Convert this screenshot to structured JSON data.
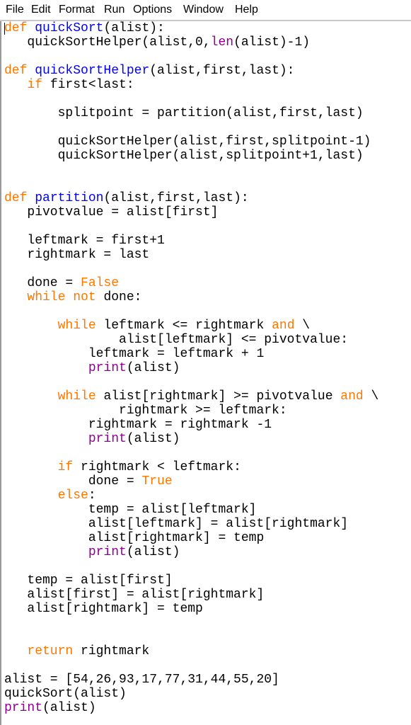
{
  "menu": [
    "File",
    "Edit",
    "Format",
    "Run",
    "Options",
    "Window",
    "Help"
  ],
  "colors": {
    "keyword": "#ff7700",
    "definition": "#0000ff",
    "builtin": "#900090",
    "text": "#000000"
  },
  "code_lines": [
    [
      [
        "def",
        "k"
      ],
      [
        " "
      ],
      [
        "quickSort",
        "d"
      ],
      [
        "(alist):"
      ]
    ],
    [
      [
        "   quickSortHelper(alist,0,"
      ],
      [
        "len",
        "b"
      ],
      [
        "(alist)-1)"
      ]
    ],
    [],
    [
      [
        "def",
        "k"
      ],
      [
        " "
      ],
      [
        "quickSortHelper",
        "d"
      ],
      [
        "(alist,first,last):"
      ]
    ],
    [
      [
        "   "
      ],
      [
        "if",
        "k"
      ],
      [
        " first<last:"
      ]
    ],
    [],
    [
      [
        "       splitpoint = partition(alist,first,last)"
      ]
    ],
    [],
    [
      [
        "       quickSortHelper(alist,first,splitpoint-1)"
      ]
    ],
    [
      [
        "       quickSortHelper(alist,splitpoint+1,last)"
      ]
    ],
    [],
    [],
    [
      [
        "def",
        "k"
      ],
      [
        " "
      ],
      [
        "partition",
        "d"
      ],
      [
        "(alist,first,last):"
      ]
    ],
    [
      [
        "   pivotvalue = alist[first]"
      ]
    ],
    [],
    [
      [
        "   leftmark = first+1"
      ]
    ],
    [
      [
        "   rightmark = last"
      ]
    ],
    [],
    [
      [
        "   done = "
      ],
      [
        "False",
        "k"
      ]
    ],
    [
      [
        "   "
      ],
      [
        "while",
        "k"
      ],
      [
        " "
      ],
      [
        "not",
        "k"
      ],
      [
        " done:"
      ]
    ],
    [],
    [
      [
        "       "
      ],
      [
        "while",
        "k"
      ],
      [
        " leftmark <= rightmark "
      ],
      [
        "and",
        "k"
      ],
      [
        " \\"
      ]
    ],
    [
      [
        "               alist[leftmark] <= pivotvalue:"
      ]
    ],
    [
      [
        "           leftmark = leftmark + 1"
      ]
    ],
    [
      [
        "           "
      ],
      [
        "print",
        "b"
      ],
      [
        "(alist)"
      ]
    ],
    [],
    [
      [
        "       "
      ],
      [
        "while",
        "k"
      ],
      [
        " alist[rightmark] >= pivotvalue "
      ],
      [
        "and",
        "k"
      ],
      [
        " \\"
      ]
    ],
    [
      [
        "               rightmark >= leftmark:"
      ]
    ],
    [
      [
        "           rightmark = rightmark -1"
      ]
    ],
    [
      [
        "           "
      ],
      [
        "print",
        "b"
      ],
      [
        "(alist)"
      ]
    ],
    [],
    [
      [
        "       "
      ],
      [
        "if",
        "k"
      ],
      [
        " rightmark < leftmark:"
      ]
    ],
    [
      [
        "           done = "
      ],
      [
        "True",
        "k"
      ]
    ],
    [
      [
        "       "
      ],
      [
        "else",
        "k"
      ],
      [
        ":"
      ]
    ],
    [
      [
        "           temp = alist[leftmark]"
      ]
    ],
    [
      [
        "           alist[leftmark] = alist[rightmark]"
      ]
    ],
    [
      [
        "           alist[rightmark] = temp"
      ]
    ],
    [
      [
        "           "
      ],
      [
        "print",
        "b"
      ],
      [
        "(alist)"
      ]
    ],
    [],
    [
      [
        "   temp = alist[first]"
      ]
    ],
    [
      [
        "   alist[first] = alist[rightmark]"
      ]
    ],
    [
      [
        "   alist[rightmark] = temp"
      ]
    ],
    [],
    [],
    [
      [
        "   "
      ],
      [
        "return",
        "k"
      ],
      [
        " rightmark"
      ]
    ],
    [],
    [
      [
        "alist = [54,26,93,17,77,31,44,55,20]"
      ]
    ],
    [
      [
        "quickSort(alist)"
      ]
    ],
    [
      [
        "print",
        "b"
      ],
      [
        "(alist)"
      ]
    ]
  ]
}
